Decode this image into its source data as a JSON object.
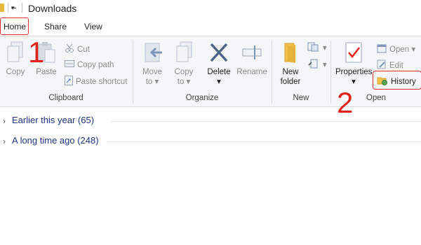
{
  "window": {
    "title": "Downloads"
  },
  "tabs": {
    "home": "Home",
    "share": "Share",
    "view": "View"
  },
  "ribbon": {
    "clipboard": {
      "group_label": "Clipboard",
      "copy": "Copy",
      "paste": "Paste",
      "cut": "Cut",
      "copy_path": "Copy path",
      "paste_shortcut": "Paste shortcut"
    },
    "organize": {
      "group_label": "Organize",
      "move_to_1": "Move",
      "move_to_2": "to",
      "copy_to_1": "Copy",
      "copy_to_2": "to",
      "delete": "Delete",
      "rename": "Rename"
    },
    "new": {
      "group_label": "New",
      "new_folder_1": "New",
      "new_folder_2": "folder"
    },
    "open": {
      "group_label": "Open",
      "properties": "Properties",
      "open": "Open",
      "edit": "Edit",
      "history": "History"
    }
  },
  "annotations": {
    "step1": "1",
    "step2": "2"
  },
  "content": {
    "groups": [
      {
        "label": "Earlier this year (65)"
      },
      {
        "label": "A long time ago (248)"
      }
    ]
  },
  "colors": {
    "annotation": "#e2231a",
    "group_header_text": "#1e3287",
    "ribbon_bg": "#f5f6f7"
  }
}
